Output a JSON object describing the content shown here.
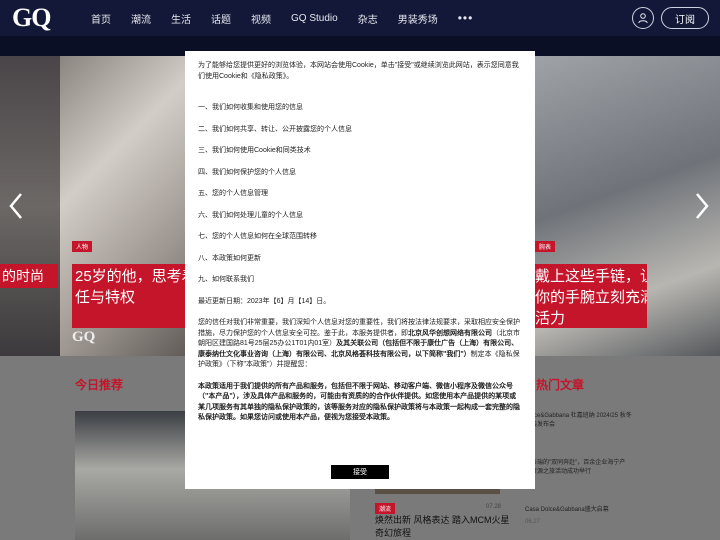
{
  "header": {
    "logo": "GQ",
    "nav": [
      "首页",
      "潮流",
      "生活",
      "话题",
      "视频",
      "GQ Studio",
      "杂志",
      "男装秀场"
    ],
    "more": "•••",
    "subscribe_label": "订阅",
    "user_icon": "user-icon"
  },
  "carousel": {
    "left_caption": "的时尚",
    "main_tag": "人物",
    "main_caption_line1": "25岁的他，思考着",
    "main_caption_line2": "任与特权",
    "right_tag": "腕表",
    "right_caption_line1": "戴上这些手链，让",
    "right_caption_line2": "你的手腕立刻充满",
    "right_caption_line3": "活力",
    "watermark": "GQ",
    "prev_icon": "chevron-left-icon",
    "next_icon": "chevron-right-icon"
  },
  "recommend": {
    "title": "今日推荐"
  },
  "hot": {
    "title": "热门文章",
    "items": [
      {
        "line1": "Dolce&Gabbana 杜嘉班纳 2024/25 秋冬",
        "line2": "男装发布会"
      },
      {
        "line1": "以亲瑞的\"双同奔赴\"，百余企业海宁产",
        "line2": "业资源之旅活动成功举行"
      },
      {
        "line1": "Casa Dolce&Gabbana盛大启幕",
        "date": "06.27"
      }
    ]
  },
  "mid_article": {
    "tag": "潮流",
    "time": "07.28",
    "title": "焕然出新 风格表达 踏入MCM火星奇幻旅程"
  },
  "modal": {
    "intro": "为了能够给您提供更好的浏览体验，本网站会使用Cookie，单击\"接受\"或继续浏览此网站，表示您同意我们使用Cookie和《隐私政策》。",
    "toc": [
      "一、我们如何收集和使用您的信息",
      "二、我们如何共享、转让、公开披露您的个人信息",
      "三、我们如何使用Cookie和同类技术",
      "四、我们如何保护您的个人信息",
      "五、您的个人信息管理",
      "六、我们如何处理儿童的个人信息",
      "七、您的个人信息如何在全球范围转移",
      "八、本政策如何更新",
      "九、如何联系我们"
    ],
    "updated": "最近更新日期：2023年【6】月【14】日。",
    "para1_part1": "您的信任对我们非常重要，我们深知个人信息对您的重要性，我们将按法律法规要求，采取相应安全保护措施，尽力保护您的个人信息安全可控。鉴于此，本服务提供者，即",
    "para1_bold": "北京风华创想网络有限公司",
    "para1_part2": "（北京市朝阳区建国路81号25层25办公1T01内01室）",
    "para1_bold2": "及其关联公司（包括但不限于康仕广告（上海）有限公司、康泰纳仕文化事业咨询（上海）有限公司、北京风格荟科技有限公司，以下简称\"我们\"）",
    "para1_part3": "制定本《隐私保护政策》（下称\"本政策\"）并提醒您：",
    "para2_bold": "本政策适用于我们提供的所有产品和服务，包括但不限于网站、移动客户端、微信小程序及微信公众号（\"本产品\"），涉及具体产品和服务的，可能由有资质的的合作伙伴提供。如您使用本产品提供的某项或某几项服务有其单独的隐私保护政策的，该等服务对应的隐私保护政策将与本政策一起构成一套完整的隐私保护政策。如果您访问或使用本产品，便视为您接受本政策。",
    "accept_label": "接受"
  }
}
